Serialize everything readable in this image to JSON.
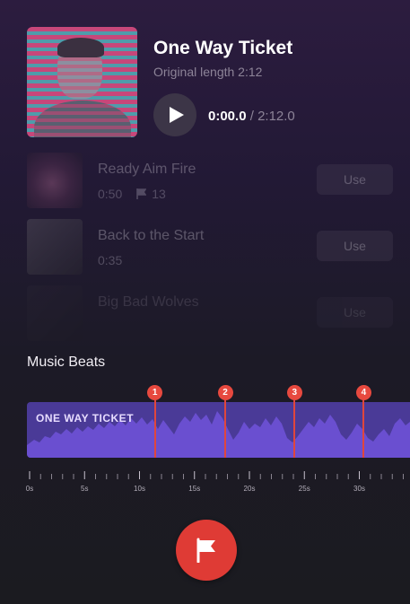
{
  "now_playing": {
    "title": "One Way Ticket",
    "subtitle": "Original length 2:12",
    "current_time": "0:00.0",
    "separator": "/",
    "total_time": "2:12.0",
    "play_icon": "play-icon"
  },
  "tracks": [
    {
      "name": "Ready Aim Fire",
      "duration": "0:50",
      "beats": "13",
      "use_label": "Use"
    },
    {
      "name": "Back to the Start",
      "duration": "0:35",
      "use_label": "Use"
    },
    {
      "name": "Big Bad Wolves",
      "use_label": "Use"
    }
  ],
  "music_beats": {
    "label": "Music Beats",
    "wave_title": "ONE WAY TICKET",
    "markers": [
      "1",
      "2",
      "3",
      "4"
    ],
    "marker_times_s": [
      11.4,
      17.8,
      24.1,
      30.4
    ],
    "ruler_labels": [
      "0s",
      "5s",
      "10s",
      "15s",
      "20s",
      "25s",
      "30s"
    ]
  },
  "add_beat_button": {
    "icon": "flag-icon"
  },
  "colors": {
    "accent_red": "#df3b35",
    "waveform_bg": "#4a3a97",
    "waveform_fill": "#6a4fd0"
  }
}
